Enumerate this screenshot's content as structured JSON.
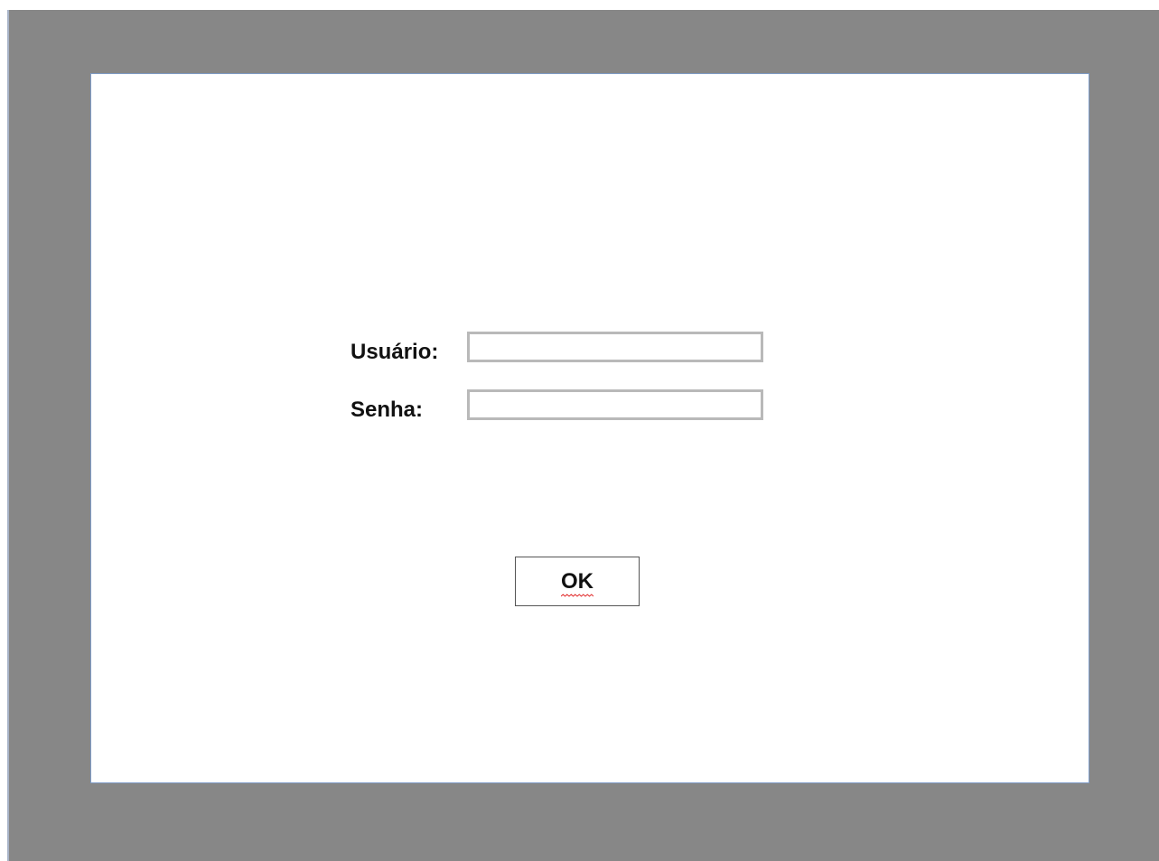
{
  "login_form": {
    "username_label": "Usuário:",
    "username_value": "",
    "password_label": "Senha:",
    "password_value": "",
    "ok_label": "OK"
  },
  "colors": {
    "canvas_background": "#878787",
    "page_background": "#ffffff",
    "page_border": "#7f9cc7",
    "field_border": "#b9b9b9",
    "spellcheck_underline": "#e02020"
  }
}
